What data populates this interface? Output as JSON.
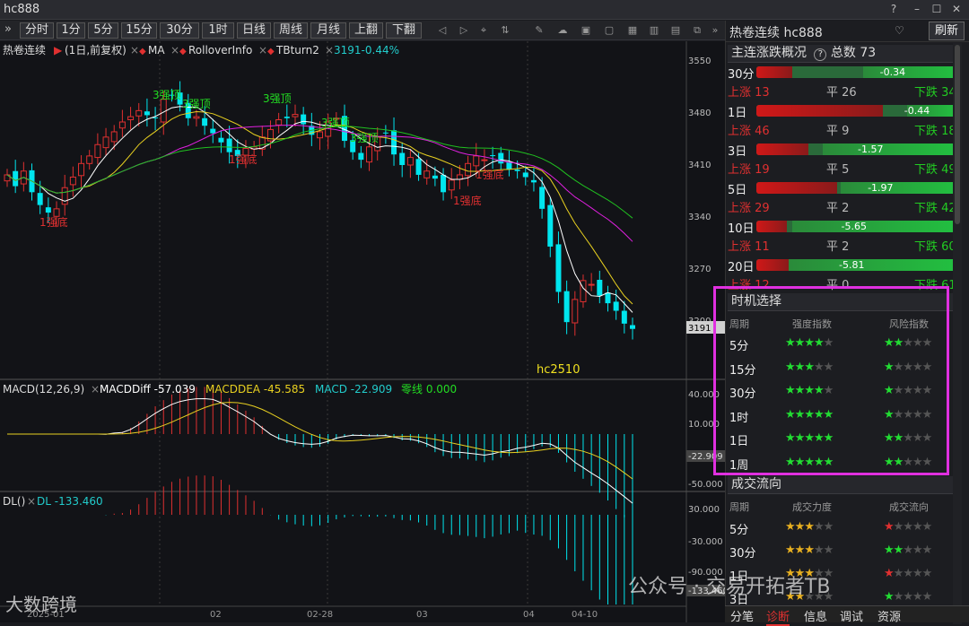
{
  "window": {
    "title": "hc888",
    "help_icon": "?",
    "min_icon": "–",
    "max_icon": "☐",
    "close_icon": "✕"
  },
  "toolbar": {
    "periods": [
      "分时",
      "1分",
      "5分",
      "15分",
      "30分",
      "1时",
      "日线",
      "周线",
      "月线",
      "上翻",
      "下翻"
    ],
    "collapse_icon": "»"
  },
  "chart": {
    "header": {
      "name": "热卷连续",
      "flag": "▶",
      "cycle": "(1日,前复权)",
      "ind_ma": "MA",
      "ind_rollover": "RolloverInfo",
      "ind_tb": "TBturn2",
      "price_change": "3191-0.44%"
    },
    "price_axis": [
      "3550",
      "3480",
      "3410",
      "3340",
      "3270",
      "3200"
    ],
    "current_price": "3191",
    "contract_label": "hc2510",
    "annotations_top": [
      "3强顶",
      "3强顶",
      "3强顶",
      "3强顶",
      "3强顶"
    ],
    "annotations_bottom": [
      "1强底",
      "1强底",
      "1强底",
      "1强底"
    ],
    "macd": {
      "title": "MACD(12,26,9)",
      "diff_label": "MACDDiff -57.039",
      "dea_label": "MACDDEA -45.585",
      "macd_label": "MACD -22.909",
      "zero_label": "零线 0.000",
      "axis": [
        "40.000",
        "10.000",
        "-22.909",
        "-50.000"
      ]
    },
    "dl": {
      "title": "DL()",
      "value_label": "DL -133.460",
      "axis": [
        "30.000",
        "-30.000",
        "-90.000",
        "-133.460"
      ]
    },
    "date_labels": [
      "2025-01",
      "02",
      "02-28",
      "03",
      "04",
      "04-10"
    ],
    "colors": {
      "up": "#e03030",
      "down": "#00e5ee",
      "ma5": "#ffffff",
      "ma10": "#e8d020",
      "ma20": "#e020e0",
      "ma30": "#20c020"
    }
  },
  "panel": {
    "title": "热卷连续 hc888",
    "dropdown_icon": "♡",
    "refresh": "刷新",
    "summary_title": "主连涨跌概况",
    "summary_help": "?",
    "summary_total": "总数 73",
    "rows": [
      {
        "period": "30分",
        "value": "-0.34",
        "red": 0.18,
        "grn": 0.47,
        "up": "上涨 13",
        "flat": "平 26",
        "down": "下跌 34"
      },
      {
        "period": "1日",
        "value": "-0.44",
        "red": 0.63,
        "grn": 0.25,
        "up": "上涨 46",
        "flat": "平 9",
        "down": "下跌 18"
      },
      {
        "period": "3日",
        "value": "-1.57",
        "red": 0.26,
        "grn": 0.67,
        "up": "上涨 19",
        "flat": "平 5",
        "down": "下跌 49"
      },
      {
        "period": "5日",
        "value": "-1.97",
        "red": 0.4,
        "grn": 0.58,
        "up": "上涨 29",
        "flat": "平 2",
        "down": "下跌 42"
      },
      {
        "period": "10日",
        "value": "-5.65",
        "red": 0.15,
        "grn": 0.82,
        "up": "上涨 11",
        "flat": "平 2",
        "down": "下跌 60"
      },
      {
        "period": "20日",
        "value": "-5.81",
        "red": 0.16,
        "grn": 0.84,
        "up": "上涨 12",
        "flat": "平 0",
        "down": "下跌 61"
      }
    ],
    "timing": {
      "title": "时机选择",
      "col1": "周期",
      "col2": "强度指数",
      "col3": "风险指数",
      "rows": [
        {
          "period": "5分",
          "strength": "★★★★★",
          "strength_on": 4,
          "risk": "★★★★★",
          "risk_on": 1.5
        },
        {
          "period": "15分",
          "strength": "★★★★★",
          "strength_on": 3,
          "risk": "★★★★★",
          "risk_on": 1
        },
        {
          "period": "30分",
          "strength": "★★★★★",
          "strength_on": 4,
          "risk": "★★★★★",
          "risk_on": 1
        },
        {
          "period": "1时",
          "strength": "★★★★★",
          "strength_on": 4.5,
          "risk": "★★★★★",
          "risk_on": 1
        },
        {
          "period": "1日",
          "strength": "★★★★★",
          "strength_on": 4.5,
          "risk": "★★★★★",
          "risk_on": 1.5
        },
        {
          "period": "1周",
          "strength": "★★★★★",
          "strength_on": 5,
          "risk": "★★★★★",
          "risk_on": 2
        }
      ]
    },
    "flow": {
      "title": "成交流向",
      "col1": "周期",
      "col2": "成交力度",
      "col3": "成交流向",
      "rows": [
        {
          "period": "5分",
          "power": "★★★★★",
          "power_on": 2.5,
          "dir": "★★★★★",
          "dir_on": 0.5,
          "dir_color": "red"
        },
        {
          "period": "30分",
          "power": "★★★★★",
          "power_on": 3,
          "dir": "★★★★★",
          "dir_on": 2,
          "dir_color": "green"
        },
        {
          "period": "1日",
          "power": "★★★★★",
          "power_on": 2.5,
          "dir": "★★★★★",
          "dir_on": 0.5,
          "dir_color": "red"
        },
        {
          "period": "3日",
          "power": "★★★★★",
          "power_on": 2,
          "dir": "★★★★★",
          "dir_on": 1,
          "dir_color": "green"
        }
      ]
    },
    "tabs": [
      "分笔",
      "诊断",
      "信息",
      "调试",
      "资源"
    ]
  },
  "watermark": "公众号 · 交易开拓者TB",
  "logo": "大数跨境"
}
